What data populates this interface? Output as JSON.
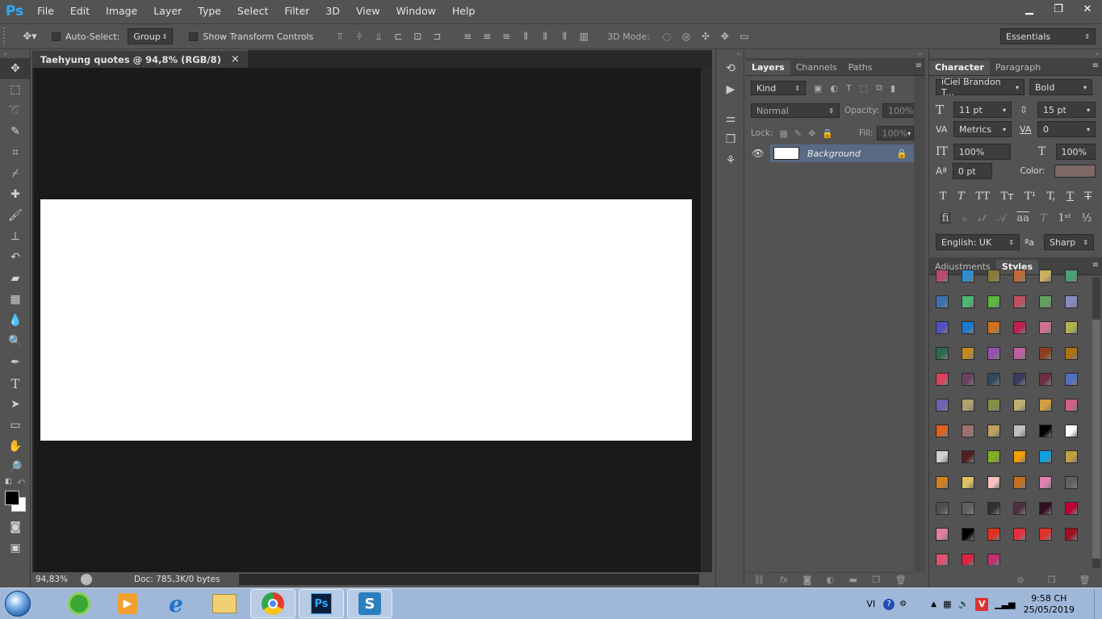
{
  "menubar": {
    "logo": "Ps",
    "items": [
      "File",
      "Edit",
      "Image",
      "Layer",
      "Type",
      "Select",
      "Filter",
      "3D",
      "View",
      "Window",
      "Help"
    ]
  },
  "options": {
    "auto_select_label": "Auto-Select:",
    "auto_select_value": "Group",
    "show_transform_label": "Show Transform Controls",
    "mode_3d_label": "3D Mode:",
    "workspace": "Essentials"
  },
  "document": {
    "tab_title": "Taehyung quotes @ 94,8% (RGB/8)",
    "close": "×",
    "zoom": "94,83%",
    "doc_info": "Doc: 785,3K/0 bytes"
  },
  "layers_panel": {
    "tabs": [
      "Layers",
      "Channels",
      "Paths"
    ],
    "filter_kind": "Kind",
    "blend_mode": "Normal",
    "opacity_label": "Opacity:",
    "opacity_value": "100%",
    "lock_label": "Lock:",
    "fill_label": "Fill:",
    "fill_value": "100%",
    "layer_name": "Background"
  },
  "character_panel": {
    "tabs": [
      "Character",
      "Paragraph"
    ],
    "font_family": "iCiel Brandon T...",
    "font_style": "Bold",
    "font_size": "11 pt",
    "leading": "15 pt",
    "kerning": "Metrics",
    "tracking": "0",
    "vertical_scale": "100%",
    "horizontal_scale": "100%",
    "baseline_shift": "0 pt",
    "color_label": "Color:",
    "color_value": "#7d6868",
    "language": "English: UK",
    "aa_method": "Sharp",
    "aa_icon_text": "ªa"
  },
  "styles_panel": {
    "tabs": [
      "Adjustments",
      "Styles"
    ],
    "swatches": [
      "#b84a6a",
      "#2a8fd0",
      "#8a7a3a",
      "#c06a3a",
      "#c8b060",
      "#4aa070",
      "#3a70b0",
      "#4ab870",
      "#5ab840",
      "#c05060",
      "#60a060",
      "#8a8ac0",
      "#5050c0",
      "#1a7ad0",
      "#d07020",
      "#c02050",
      "#d07090",
      "#b0b050",
      "#2a6a4a",
      "#c08a20",
      "#9a50b0",
      "#c060a0",
      "#8a4020",
      "#b07010",
      "#e04060",
      "#6a4060",
      "#304a60",
      "#3a3a60",
      "#6a3040",
      "#5070c0",
      "#7060b0",
      "#b0a070",
      "#809040",
      "#c0b070",
      "#d0a040",
      "#d06080",
      "#e06020",
      "#a07070",
      "#c0a060",
      "#c0c0c0",
      "#000000",
      "#ffffff",
      "#d0d0d0",
      "#502020",
      "#80b020",
      "#f0a000",
      "#10a0e0",
      "#c0a040",
      "#d08020",
      "#e0c060",
      "#ffc0c0",
      "#c07020",
      "#e080b0",
      "#606060",
      "#505050",
      "#606060",
      "#303030",
      "#503040",
      "#301020",
      "#c00030",
      "#e080a0",
      "#000000",
      "#e03020",
      "#e03040",
      "#e03030",
      "#a01020",
      "#e05070",
      "#e02040",
      "#c03070"
    ]
  },
  "taskbar": {
    "lang": "VI",
    "time": "9:58 CH",
    "date": "25/05/2019"
  }
}
